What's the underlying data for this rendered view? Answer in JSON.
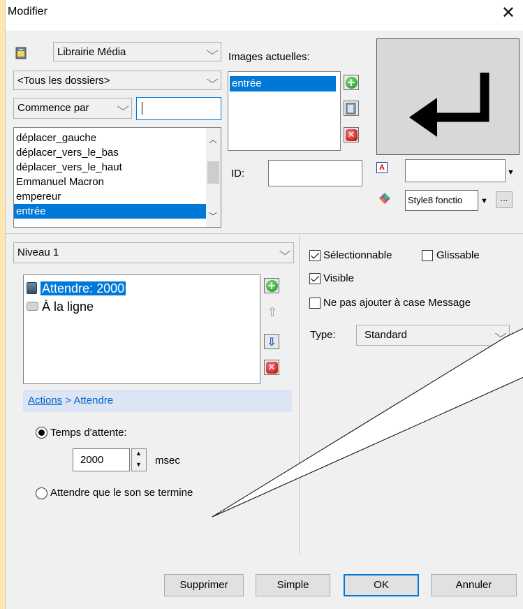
{
  "dialog": {
    "title": "Modifier",
    "close_glyph": "✕"
  },
  "library": {
    "combo_value": "Librairie Média",
    "folder_value": "<Tous les dossiers>",
    "filter_mode": "Commence par",
    "search_value": "",
    "items": [
      "déplacer_gauche",
      "déplacer_vers_le_bas",
      "déplacer_vers_le_haut",
      "Emmanuel Macron",
      "empereur",
      "entrée"
    ],
    "selected_item": "entrée"
  },
  "images": {
    "label": "Images actuelles:",
    "items": [
      "entrée"
    ],
    "preview_glyph": "↵"
  },
  "id_field": {
    "label": "ID:",
    "value": ""
  },
  "text_field": {
    "value": ""
  },
  "style": {
    "value": "Style8 fonctio",
    "more_label": "..."
  },
  "level": {
    "value": "Niveau 1"
  },
  "actions": {
    "items": [
      {
        "icon": "clock-icon",
        "label": "Attendre: 2000",
        "selected": true
      },
      {
        "icon": "line-break-icon",
        "label": "À la ligne",
        "selected": false
      }
    ]
  },
  "breadcrumb": {
    "link": "Actions",
    "sep": " > ",
    "current": "Attendre"
  },
  "wait": {
    "option_time": "Temps d'attente:",
    "value": "2000",
    "unit": "msec",
    "option_sound": "Attendre que le son se termine",
    "selected_option": "time"
  },
  "properties": {
    "selectable_label": "Sélectionnable",
    "selectable": true,
    "draggable_label": "Glissable",
    "draggable": false,
    "visible_label": "Visible",
    "visible": true,
    "no_message_label": "Ne pas ajouter à case Message",
    "no_message": false,
    "type_label": "Type:",
    "type_value": "Standard"
  },
  "footer": {
    "delete_label": "Supprimer",
    "simple_label": "Simple",
    "ok_label": "OK",
    "cancel_label": "Annuler"
  },
  "colors": {
    "accent": "#0078d7",
    "link": "#0066cc",
    "breadcrumb_bg": "#dde4f4"
  }
}
